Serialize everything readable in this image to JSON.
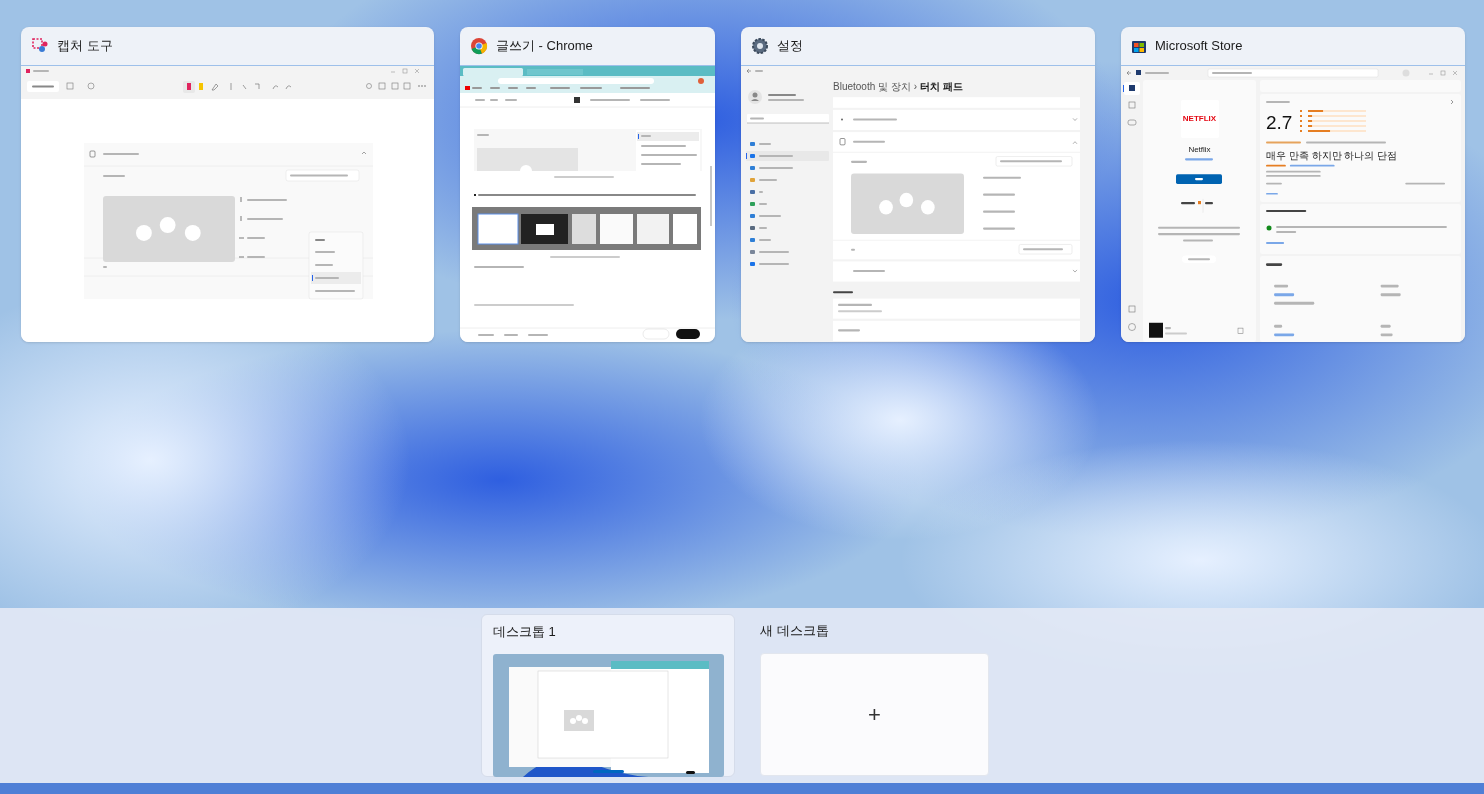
{
  "windows": [
    {
      "kind": "snipping",
      "title": "캡처 도구"
    },
    {
      "kind": "chrome",
      "title": "글쓰기 - Chrome"
    },
    {
      "kind": "settings",
      "title": "설정",
      "preview": {
        "breadcrumb": "Bluetooth 및 장치",
        "separator": "›",
        "page_title": "터치 패드"
      }
    },
    {
      "kind": "store",
      "title": "Microsoft Store",
      "preview": {
        "logo": "NETFLIX",
        "name": "Netflix",
        "big_rating": "2.7",
        "review_title": "매우 만족 하지만 하나의 단점"
      }
    }
  ],
  "desktops": [
    {
      "title": "데스크톱 1",
      "selected": true
    },
    {
      "title": "새 데스크톱",
      "kind": "new",
      "symbol": "+",
      "selected": false
    }
  ]
}
